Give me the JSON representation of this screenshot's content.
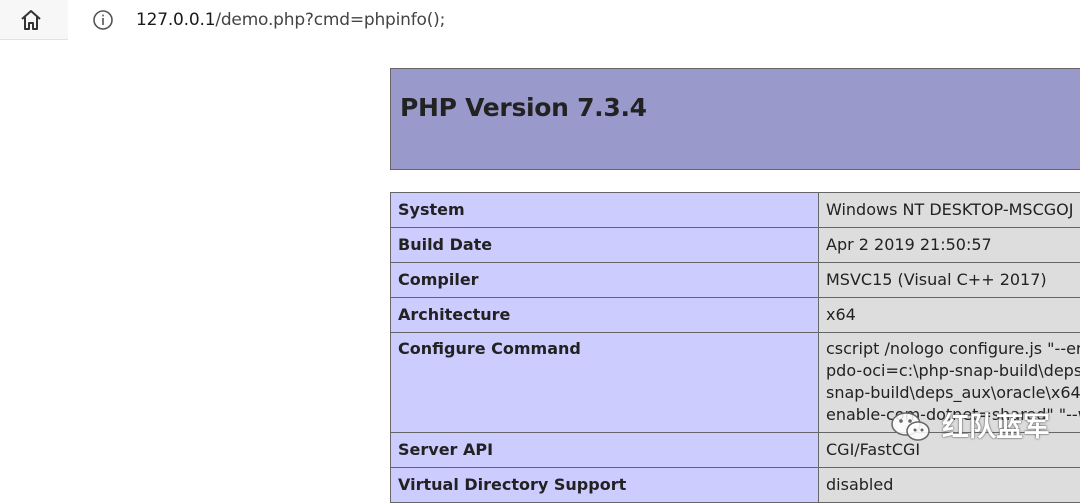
{
  "browser": {
    "url_host": "127.0.0.1",
    "url_path": "/demo.php?cmd=phpinfo();"
  },
  "php": {
    "title": "PHP Version 7.3.4",
    "rows": [
      {
        "key": "System",
        "value": "Windows NT DESKTOP-MSCGOJ"
      },
      {
        "key": "Build Date",
        "value": "Apr 2 2019 21:50:57"
      },
      {
        "key": "Compiler",
        "value": "MSVC15 (Visual C++ 2017)"
      },
      {
        "key": "Architecture",
        "value": "x64"
      },
      {
        "key": "Configure Command",
        "value_lines": [
          "cscript /nologo configure.js \"--er",
          "pdo-oci=c:\\php-snap-build\\deps",
          "snap-build\\deps_aux\\oracle\\x64\\",
          "enable-com-dotnet=shared\" \"--w"
        ]
      },
      {
        "key": "Server API",
        "value": "CGI/FastCGI"
      },
      {
        "key": "Virtual Directory Support",
        "value": "disabled"
      }
    ]
  },
  "watermark": {
    "text": "红队蓝军"
  }
}
